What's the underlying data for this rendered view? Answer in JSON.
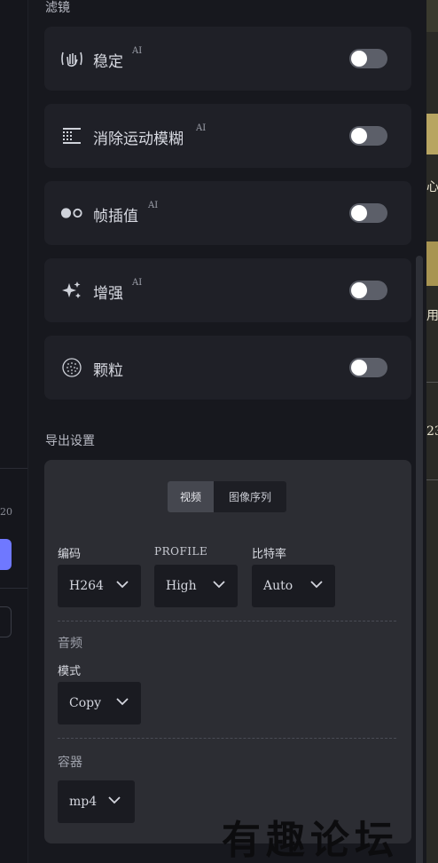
{
  "left_strip": {
    "number": "20"
  },
  "right_strip": {
    "texts": [
      "心",
      "用",
      "23"
    ]
  },
  "filters": {
    "title": "滤镜",
    "items": [
      {
        "label": "稳定",
        "ai": "AI",
        "icon": "stabilize-hand-icon",
        "enabled": false
      },
      {
        "label": "消除运动模糊",
        "ai": "AI",
        "icon": "motion-blur-grid-icon",
        "enabled": false
      },
      {
        "label": "帧插值",
        "ai": "AI",
        "icon": "frame-interpolation-dots-icon",
        "enabled": false
      },
      {
        "label": "增强",
        "ai": "AI",
        "icon": "sparkle-enhance-icon",
        "enabled": false
      },
      {
        "label": "颗粒",
        "ai": "",
        "icon": "grain-circle-icon",
        "enabled": false
      }
    ]
  },
  "export": {
    "title": "导出设置",
    "tabs": [
      {
        "label": "视频",
        "active": true
      },
      {
        "label": "图像序列",
        "active": false
      }
    ],
    "encoding_label": "编码",
    "encoding_value": "H264",
    "profile_label": "PROFILE",
    "profile_value": "High",
    "bitrate_label": "比特率",
    "bitrate_value": "Auto",
    "audio_title": "音频",
    "mode_label": "模式",
    "mode_value": "Copy",
    "container_title": "容器",
    "container_value": "mp4"
  },
  "watermark": "有趣论坛",
  "colors": {
    "background": "#17181e",
    "card": "#1f2027",
    "export_card": "#2c2d33",
    "toggle_off": "#5c5f69",
    "accent_blue": "#6f78ff"
  }
}
